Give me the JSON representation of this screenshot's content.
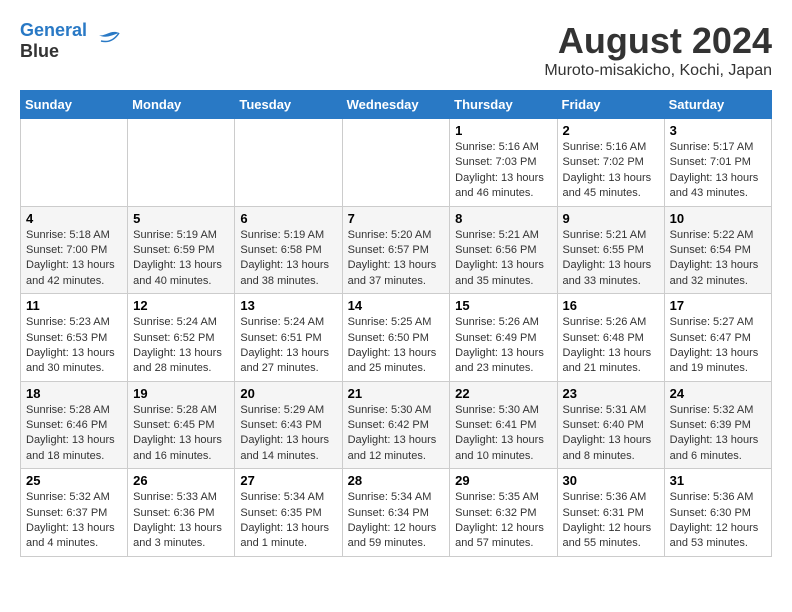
{
  "header": {
    "logo_line1": "General",
    "logo_line2": "Blue",
    "month_year": "August 2024",
    "location": "Muroto-misakicho, Kochi, Japan"
  },
  "weekdays": [
    "Sunday",
    "Monday",
    "Tuesday",
    "Wednesday",
    "Thursday",
    "Friday",
    "Saturday"
  ],
  "weeks": [
    [
      {
        "day": "",
        "info": ""
      },
      {
        "day": "",
        "info": ""
      },
      {
        "day": "",
        "info": ""
      },
      {
        "day": "",
        "info": ""
      },
      {
        "day": "1",
        "sunrise": "5:16 AM",
        "sunset": "7:03 PM",
        "daylight": "13 hours and 46 minutes."
      },
      {
        "day": "2",
        "sunrise": "5:16 AM",
        "sunset": "7:02 PM",
        "daylight": "13 hours and 45 minutes."
      },
      {
        "day": "3",
        "sunrise": "5:17 AM",
        "sunset": "7:01 PM",
        "daylight": "13 hours and 43 minutes."
      }
    ],
    [
      {
        "day": "4",
        "sunrise": "5:18 AM",
        "sunset": "7:00 PM",
        "daylight": "13 hours and 42 minutes."
      },
      {
        "day": "5",
        "sunrise": "5:19 AM",
        "sunset": "6:59 PM",
        "daylight": "13 hours and 40 minutes."
      },
      {
        "day": "6",
        "sunrise": "5:19 AM",
        "sunset": "6:58 PM",
        "daylight": "13 hours and 38 minutes."
      },
      {
        "day": "7",
        "sunrise": "5:20 AM",
        "sunset": "6:57 PM",
        "daylight": "13 hours and 37 minutes."
      },
      {
        "day": "8",
        "sunrise": "5:21 AM",
        "sunset": "6:56 PM",
        "daylight": "13 hours and 35 minutes."
      },
      {
        "day": "9",
        "sunrise": "5:21 AM",
        "sunset": "6:55 PM",
        "daylight": "13 hours and 33 minutes."
      },
      {
        "day": "10",
        "sunrise": "5:22 AM",
        "sunset": "6:54 PM",
        "daylight": "13 hours and 32 minutes."
      }
    ],
    [
      {
        "day": "11",
        "sunrise": "5:23 AM",
        "sunset": "6:53 PM",
        "daylight": "13 hours and 30 minutes."
      },
      {
        "day": "12",
        "sunrise": "5:24 AM",
        "sunset": "6:52 PM",
        "daylight": "13 hours and 28 minutes."
      },
      {
        "day": "13",
        "sunrise": "5:24 AM",
        "sunset": "6:51 PM",
        "daylight": "13 hours and 27 minutes."
      },
      {
        "day": "14",
        "sunrise": "5:25 AM",
        "sunset": "6:50 PM",
        "daylight": "13 hours and 25 minutes."
      },
      {
        "day": "15",
        "sunrise": "5:26 AM",
        "sunset": "6:49 PM",
        "daylight": "13 hours and 23 minutes."
      },
      {
        "day": "16",
        "sunrise": "5:26 AM",
        "sunset": "6:48 PM",
        "daylight": "13 hours and 21 minutes."
      },
      {
        "day": "17",
        "sunrise": "5:27 AM",
        "sunset": "6:47 PM",
        "daylight": "13 hours and 19 minutes."
      }
    ],
    [
      {
        "day": "18",
        "sunrise": "5:28 AM",
        "sunset": "6:46 PM",
        "daylight": "13 hours and 18 minutes."
      },
      {
        "day": "19",
        "sunrise": "5:28 AM",
        "sunset": "6:45 PM",
        "daylight": "13 hours and 16 minutes."
      },
      {
        "day": "20",
        "sunrise": "5:29 AM",
        "sunset": "6:43 PM",
        "daylight": "13 hours and 14 minutes."
      },
      {
        "day": "21",
        "sunrise": "5:30 AM",
        "sunset": "6:42 PM",
        "daylight": "13 hours and 12 minutes."
      },
      {
        "day": "22",
        "sunrise": "5:30 AM",
        "sunset": "6:41 PM",
        "daylight": "13 hours and 10 minutes."
      },
      {
        "day": "23",
        "sunrise": "5:31 AM",
        "sunset": "6:40 PM",
        "daylight": "13 hours and 8 minutes."
      },
      {
        "day": "24",
        "sunrise": "5:32 AM",
        "sunset": "6:39 PM",
        "daylight": "13 hours and 6 minutes."
      }
    ],
    [
      {
        "day": "25",
        "sunrise": "5:32 AM",
        "sunset": "6:37 PM",
        "daylight": "13 hours and 4 minutes."
      },
      {
        "day": "26",
        "sunrise": "5:33 AM",
        "sunset": "6:36 PM",
        "daylight": "13 hours and 3 minutes."
      },
      {
        "day": "27",
        "sunrise": "5:34 AM",
        "sunset": "6:35 PM",
        "daylight": "13 hours and 1 minute."
      },
      {
        "day": "28",
        "sunrise": "5:34 AM",
        "sunset": "6:34 PM",
        "daylight": "12 hours and 59 minutes."
      },
      {
        "day": "29",
        "sunrise": "5:35 AM",
        "sunset": "6:32 PM",
        "daylight": "12 hours and 57 minutes."
      },
      {
        "day": "30",
        "sunrise": "5:36 AM",
        "sunset": "6:31 PM",
        "daylight": "12 hours and 55 minutes."
      },
      {
        "day": "31",
        "sunrise": "5:36 AM",
        "sunset": "6:30 PM",
        "daylight": "12 hours and 53 minutes."
      }
    ]
  ]
}
